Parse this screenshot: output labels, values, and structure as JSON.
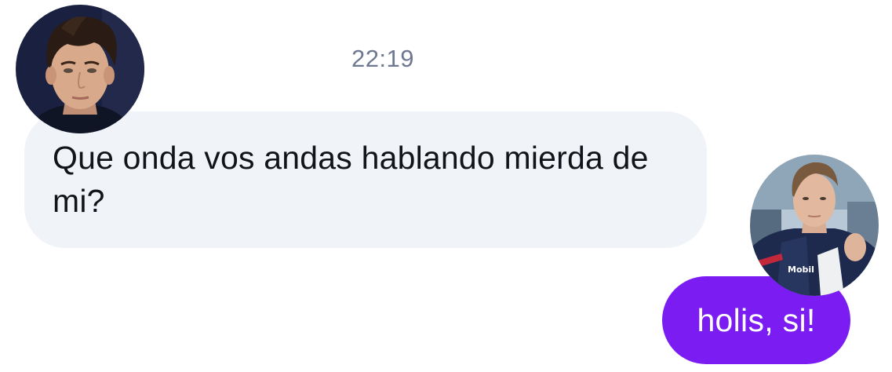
{
  "conversation": {
    "timestamp": "22:19",
    "messages": [
      {
        "direction": "incoming",
        "text": "Que onda vos andas hablando mierda de mi?"
      },
      {
        "direction": "outgoing",
        "text": "holis, si!"
      }
    ]
  },
  "avatars": {
    "incoming_icon": "person-photo-avatar",
    "outgoing_icon": "person-photo-avatar",
    "outgoing_jacket_text": "Mobil"
  },
  "colors": {
    "incoming_bubble": "#f0f4f9",
    "outgoing_bubble": "#7a1cf2",
    "timestamp": "#6e7891"
  }
}
